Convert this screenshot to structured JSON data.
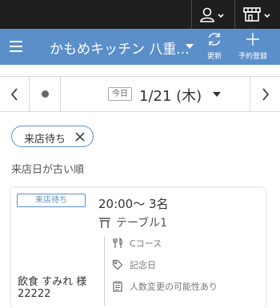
{
  "header": {
    "store_name": "かもめキッチン 八重...",
    "refresh_label": "更新",
    "new_reservation_label": "予約登録",
    "bg_color": "#5b8fc9"
  },
  "date_nav": {
    "today_label": "今日",
    "date": "1/21 (木)"
  },
  "filter": {
    "chip_label": "来店待ち"
  },
  "sort_label": "来店日が古い順",
  "reservation": {
    "status": "来店待ち",
    "time_and_party": "20:00〜 3名",
    "table": "テーブル1",
    "course": "Cコース",
    "occasion": "記念日",
    "note": "人数変更の可能性あり",
    "guest_name": "飲食 すみれ 様",
    "guest_number": "22222"
  }
}
